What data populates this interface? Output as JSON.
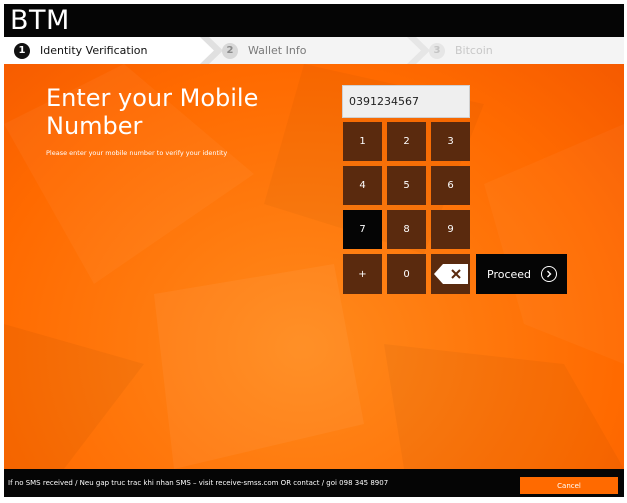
{
  "app": {
    "title": "BTM"
  },
  "steps": [
    {
      "number": "1",
      "label": "Identity Verification",
      "state": "active"
    },
    {
      "number": "2",
      "label": "Wallet Info",
      "state": "pending"
    },
    {
      "number": "3",
      "label": "Bitcoin",
      "state": "pending"
    }
  ],
  "main": {
    "heading": "Enter your Mobile Number",
    "subheading": "Please enter your mobile number to verify your identity",
    "phone_value": "0391234567"
  },
  "keypad": {
    "rows": [
      [
        "1",
        "2",
        "3"
      ],
      [
        "4",
        "5",
        "6"
      ],
      [
        "7",
        "8",
        "9"
      ],
      [
        "+",
        "0"
      ]
    ],
    "active_key": "7",
    "backspace_icon": "backspace-icon",
    "proceed_label": "Proceed",
    "proceed_icon": "chevron-right-circle-icon"
  },
  "footer": {
    "message": "If no SMS received / Neu gap truc trac khi nhan SMS – visit receive-smss.com OR contact / goi 098 345 8907",
    "cancel_label": "Cancel"
  },
  "colors": {
    "accent": "#ff6a00",
    "key_bg": "#5a2a0e",
    "dark": "#050505"
  }
}
